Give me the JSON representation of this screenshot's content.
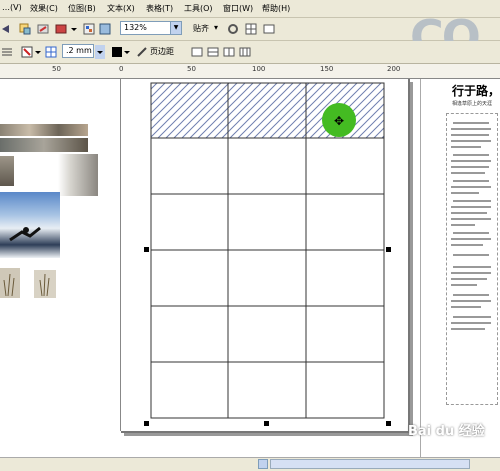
{
  "menu": {
    "items": [
      {
        "label": "…(V)"
      },
      {
        "label": "效果(C)"
      },
      {
        "label": "位图(B)"
      },
      {
        "label": "文本(X)"
      },
      {
        "label": "表格(T)"
      },
      {
        "label": "工具(O)"
      },
      {
        "label": "窗口(W)"
      },
      {
        "label": "帮助(H)"
      }
    ]
  },
  "toolbar": {
    "zoom_value": "132%",
    "snap_label": "贴齐",
    "outline_width": ".2 mm",
    "page_border_label": "页边距",
    "logo_text": "CO"
  },
  "ruler": {
    "labels": [
      "50",
      "0",
      "50",
      "100",
      "150",
      "200"
    ]
  },
  "document": {
    "right_title": "行于路，",
    "right_subtitle": "相逢草原上的天涯"
  },
  "watermark": "Bai du 经验",
  "colors": {
    "cursor_highlight": "#44bb22",
    "table_hatch": "#7080b0",
    "ui_background": "#ece9d8"
  }
}
